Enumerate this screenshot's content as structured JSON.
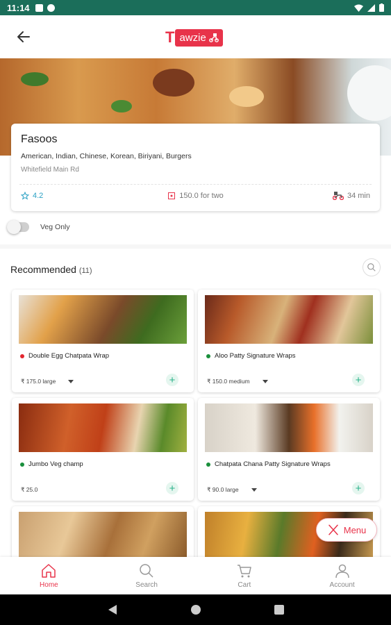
{
  "status_bar": {
    "time": "11:14"
  },
  "header": {
    "logo_letter": "T",
    "logo_text": "awzie"
  },
  "restaurant": {
    "name": "Fasoos",
    "cuisines": "American, Indian, Chinese, Korean, Biriyani, Burgers",
    "address": "Whitefield Main Rd",
    "rating": "4.2",
    "cost": "150.0 for two",
    "delivery_time": "34 min"
  },
  "filters": {
    "veg_only_label": "Veg Only",
    "veg_only_on": false
  },
  "recommended": {
    "title": "Recommended",
    "count": "(11)",
    "items": [
      {
        "name": "Double Egg Chatpata Wrap",
        "price": "₹ 175.0 large",
        "veg": false,
        "has_dropdown": true
      },
      {
        "name": "Aloo Patty Signature Wraps",
        "price": "₹ 150.0 medium",
        "veg": true,
        "has_dropdown": true
      },
      {
        "name": "Jumbo Veg champ",
        "price": "₹ 25.0",
        "veg": true,
        "has_dropdown": false
      },
      {
        "name": "Chatpata Chana Patty Signature Wraps",
        "price": "₹ 90.0 large",
        "veg": true,
        "has_dropdown": true
      },
      {
        "name": "",
        "price": "",
        "veg": true,
        "has_dropdown": false
      },
      {
        "name": "",
        "price": "",
        "veg": true,
        "has_dropdown": false
      }
    ]
  },
  "menu_button": {
    "label": "Menu"
  },
  "bottom_nav": [
    {
      "label": "Home",
      "icon": "home-icon",
      "active": true
    },
    {
      "label": "Search",
      "icon": "search-icon",
      "active": false
    },
    {
      "label": "Cart",
      "icon": "cart-icon",
      "active": false
    },
    {
      "label": "Account",
      "icon": "account-icon",
      "active": false
    }
  ],
  "colors": {
    "brand": "#e8334a",
    "status_bar": "#1b6e5a",
    "rating": "#2aa1c4",
    "veg": "#1a8f3c",
    "non_veg": "#e3262f",
    "add": "#2ab28a"
  }
}
